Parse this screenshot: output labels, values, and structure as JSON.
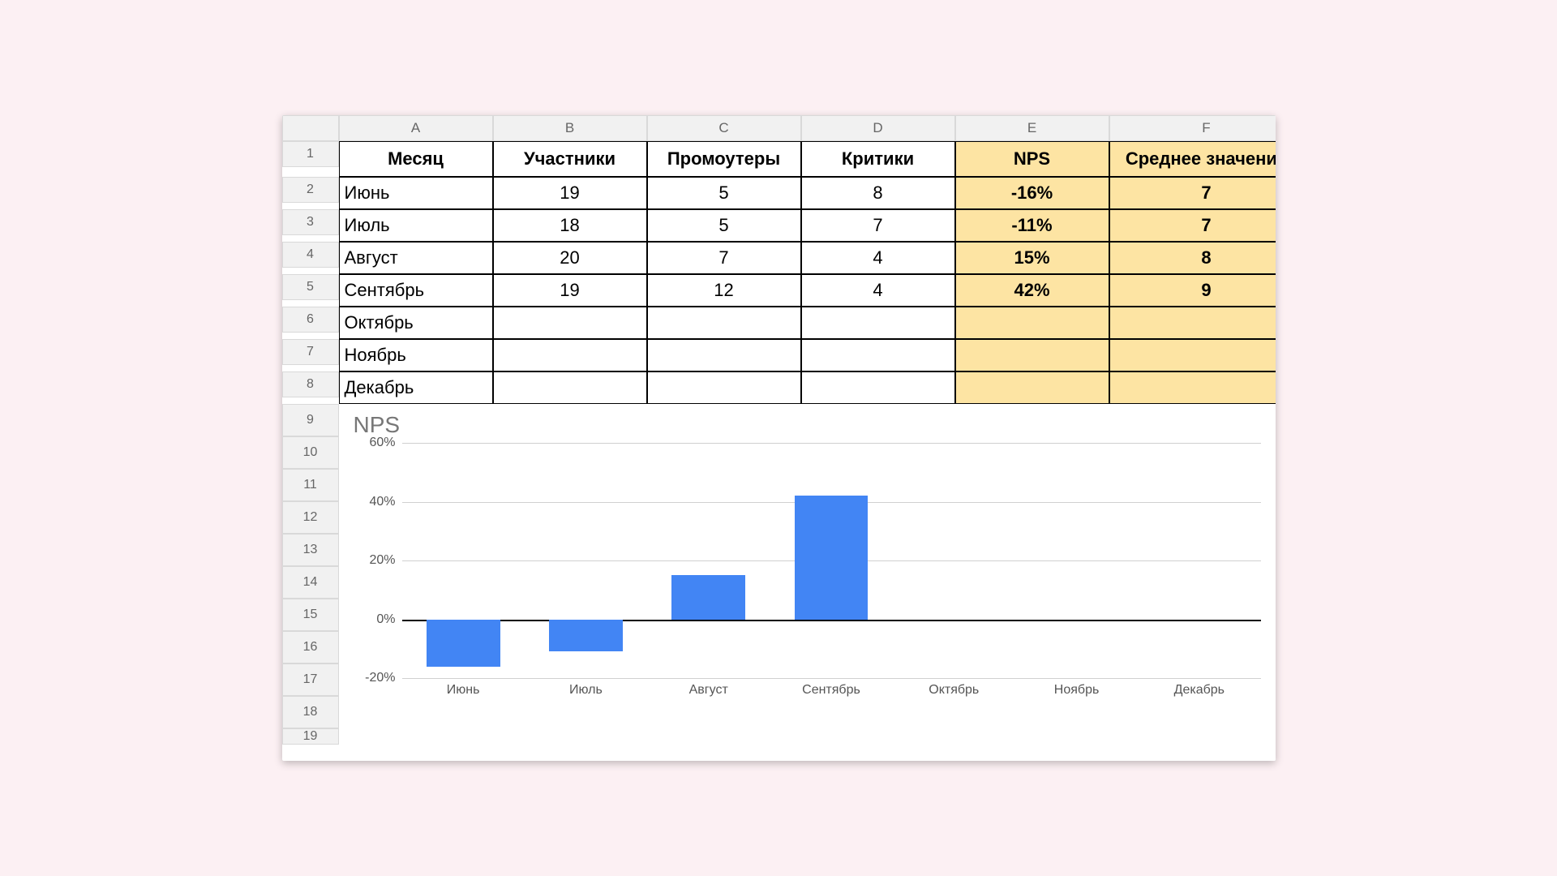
{
  "columns": [
    "A",
    "B",
    "C",
    "D",
    "E",
    "F"
  ],
  "row_numbers": [
    "1",
    "2",
    "3",
    "4",
    "5",
    "6",
    "7",
    "8",
    "9",
    "10",
    "11",
    "12",
    "13",
    "14",
    "15",
    "16",
    "17",
    "18",
    "19"
  ],
  "headers": {
    "month": "Месяц",
    "participants": "Участники",
    "promoters": "Промоутеры",
    "critics": "Критики",
    "nps": "NPS",
    "avg": "Среднее значение"
  },
  "rows": [
    {
      "month": "Июнь",
      "participants": "19",
      "promoters": "5",
      "critics": "8",
      "nps": "-16%",
      "avg": "7"
    },
    {
      "month": "Июль",
      "participants": "18",
      "promoters": "5",
      "critics": "7",
      "nps": "-11%",
      "avg": "7"
    },
    {
      "month": "Август",
      "participants": "20",
      "promoters": "7",
      "critics": "4",
      "nps": "15%",
      "avg": "8"
    },
    {
      "month": "Сентябрь",
      "participants": "19",
      "promoters": "12",
      "critics": "4",
      "nps": "42%",
      "avg": "9"
    },
    {
      "month": "Октябрь",
      "participants": "",
      "promoters": "",
      "critics": "",
      "nps": "",
      "avg": ""
    },
    {
      "month": "Ноябрь",
      "participants": "",
      "promoters": "",
      "critics": "",
      "nps": "",
      "avg": ""
    },
    {
      "month": "Декабрь",
      "participants": "",
      "promoters": "",
      "critics": "",
      "nps": "",
      "avg": ""
    }
  ],
  "chart_data": {
    "type": "bar",
    "title": "NPS",
    "categories": [
      "Июнь",
      "Июль",
      "Август",
      "Сентябрь",
      "Октябрь",
      "Ноябрь",
      "Декабрь"
    ],
    "values": [
      -16,
      -11,
      15,
      42,
      null,
      null,
      null
    ],
    "ylim": [
      -20,
      60
    ],
    "yticks": [
      -20,
      0,
      20,
      40,
      60
    ],
    "ylabels": [
      "-20%",
      "0%",
      "20%",
      "40%",
      "60%"
    ],
    "xlabel": "",
    "ylabel": ""
  },
  "colors": {
    "highlight": "#fde4a3",
    "bar": "#4285f4"
  }
}
